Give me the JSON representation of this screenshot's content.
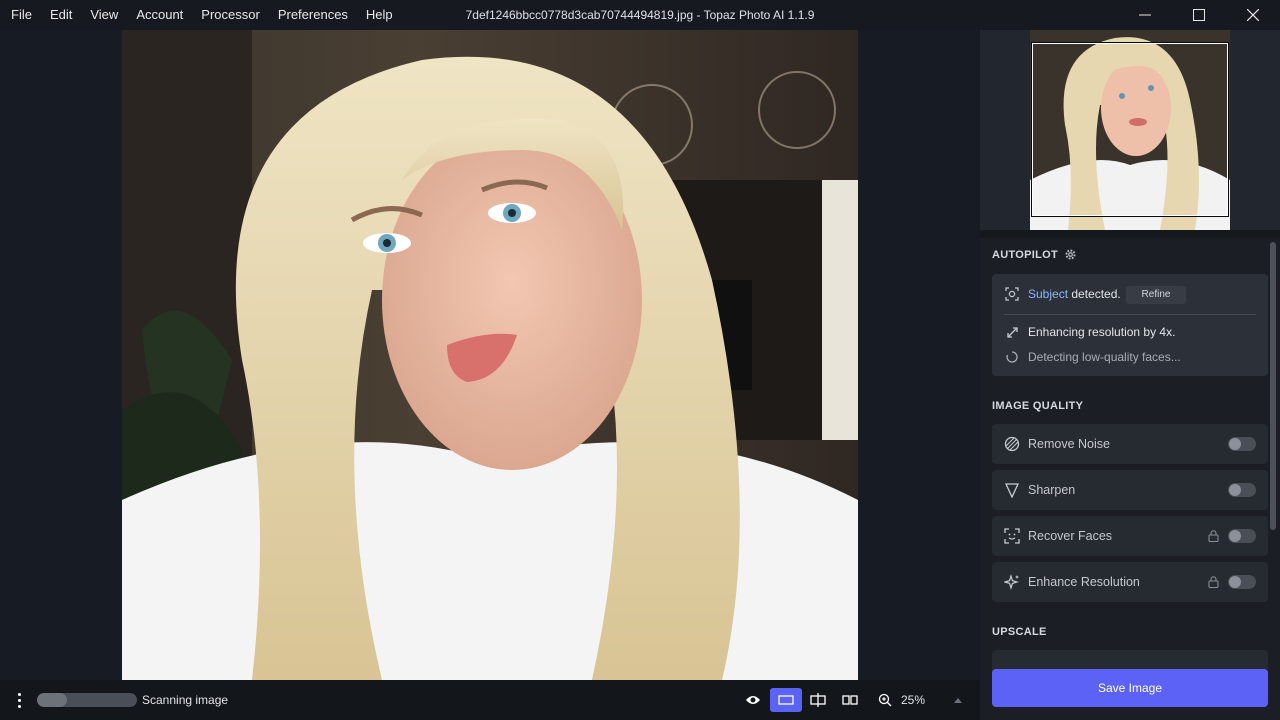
{
  "menu": {
    "items": [
      "File",
      "Edit",
      "View",
      "Account",
      "Processor",
      "Preferences",
      "Help"
    ]
  },
  "window": {
    "title": "7def1246bbcc0778d3cab70744494819.jpg - Topaz Photo AI 1.1.9"
  },
  "bottom_bar": {
    "progress_fraction": 0.3,
    "status_label": "Scanning image",
    "zoom_label": "25%",
    "active_view": "single"
  },
  "autopilot": {
    "title": "AUTOPILOT",
    "subject_link": "Subject",
    "subject_text": " detected.",
    "refine_label": "Refine",
    "enhancing_text": "Enhancing resolution by 4x.",
    "detecting_text": "Detecting low-quality faces..."
  },
  "image_quality": {
    "title": "IMAGE QUALITY",
    "items": [
      {
        "label": "Remove Noise",
        "icon": "remove-noise-icon",
        "locked": false,
        "enabled": false
      },
      {
        "label": "Sharpen",
        "icon": "sharpen-icon",
        "locked": false,
        "enabled": false
      },
      {
        "label": "Recover Faces",
        "icon": "recover-faces-icon",
        "locked": true,
        "enabled": false
      },
      {
        "label": "Enhance Resolution",
        "icon": "enhance-resolution-icon",
        "locked": true,
        "enabled": false
      }
    ]
  },
  "upscale": {
    "title": "UPSCALE"
  },
  "save": {
    "label": "Save Image"
  },
  "colors": {
    "accent": "#5c62f6",
    "link": "#8fb4ff",
    "background": "#161a20",
    "panel": "#1b1e24"
  }
}
